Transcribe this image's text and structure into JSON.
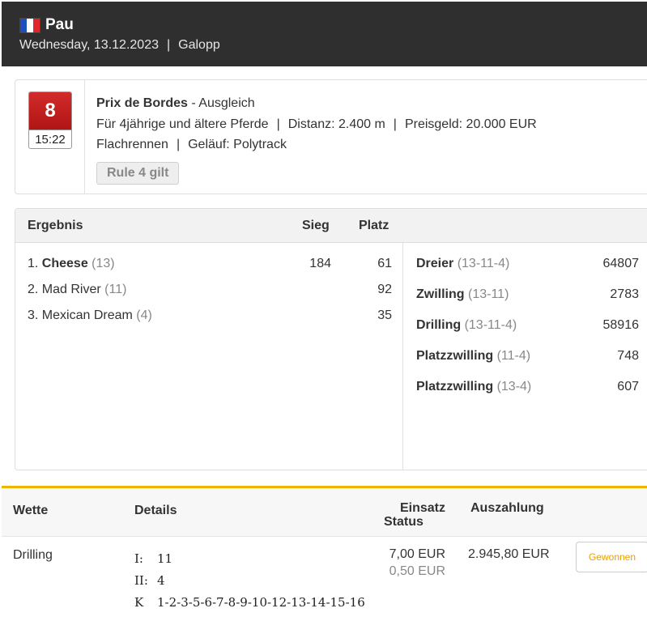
{
  "header": {
    "flag_colors": [
      "#1f4fbf",
      "#ffffff",
      "#e0262b"
    ],
    "venue": "Pau",
    "date": "Wednesday, 13.12.2023",
    "separator": "|",
    "type": "Galopp"
  },
  "race": {
    "number": "8",
    "time": "15:22",
    "name": "Prix de Bordes",
    "category": "- Ausgleich",
    "conditions": "Für 4jährige und ältere Pferde",
    "distance": "Distanz: 2.400 m",
    "prize": "Preisgeld: 20.000 EUR",
    "race_type": "Flachrennen",
    "ground": "Geläuf: Polytrack",
    "rule_label": "Rule 4 gilt",
    "badge_color": "#c41e1e"
  },
  "results": {
    "header": {
      "title": "Ergebnis",
      "win": "Sieg",
      "place": "Platz"
    },
    "runners": [
      {
        "pos": "1.",
        "name": "Cheese",
        "num": "(13)",
        "win": "184",
        "place": "61"
      },
      {
        "pos": "2.",
        "name": "Mad River",
        "num": "(11)",
        "win": "",
        "place": "92"
      },
      {
        "pos": "3.",
        "name": "Mexican Dream",
        "num": "(4)",
        "win": "",
        "place": "35"
      }
    ],
    "bets": [
      {
        "name": "Dreier",
        "combo": "(13-11-4)",
        "payout": "64807"
      },
      {
        "name": "Zwilling",
        "combo": "(13-11)",
        "payout": "2783"
      },
      {
        "name": "Drilling",
        "combo": "(13-11-4)",
        "payout": "58916"
      },
      {
        "name": "Platzzwilling",
        "combo": "(11-4)",
        "payout": "748"
      },
      {
        "name": "Platzzwilling",
        "combo": "(13-4)",
        "payout": "607"
      }
    ]
  },
  "wager": {
    "accent": "#f0b400",
    "header": {
      "bet": "Wette",
      "details": "Details",
      "stake": "Einsatz",
      "status": "Status",
      "payout": "Auszahlung"
    },
    "row": {
      "bet": "Drilling",
      "details": [
        {
          "label": "I:",
          "value": "11"
        },
        {
          "label": "II:",
          "value": "4"
        },
        {
          "label": "K",
          "value": "1-2-3-5-6-7-8-9-10-12-13-14-15-16"
        }
      ],
      "stake": "7,00 EUR",
      "stake_unit": "0,50 EUR",
      "payout": "2.945,80 EUR",
      "status_button": "Gewonnen"
    }
  }
}
